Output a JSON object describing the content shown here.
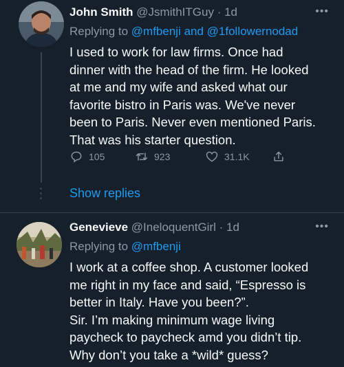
{
  "tweet1": {
    "name": "John Smith",
    "handle": "@JsmithITGuy",
    "time": "· 1d",
    "replying_prefix": "Replying to ",
    "replying_users": "@mfbenji and @1followernodad",
    "text_lines": [
      "I used to work for law firms. Once had",
      "dinner with the head of the firm. He looked",
      "at me and my wife and asked what our",
      "favorite bistro in Paris was. We've never",
      "been to Paris. Never even mentioned Paris.",
      "That was his starter question."
    ],
    "replies": "105",
    "retweets": "923",
    "likes": "31.1K"
  },
  "show_replies": "Show replies",
  "tweet2": {
    "name": "Genevieve",
    "handle": "@IneloquentGirl",
    "time": "· 1d",
    "replying_prefix": "Replying to ",
    "replying_users": "@mfbenji",
    "text_lines": [
      "I work at a coffee shop. A customer looked",
      "me right in my face and said, “Espresso is",
      "better in Italy. Have you been?”.",
      "Sir. I’m making minimum wage living",
      "paycheck to paycheck amd you didn’t tip.",
      "Why don’t you take a *wild* guess?"
    ]
  },
  "more_label": "•••",
  "colors": {
    "background": "#15202b",
    "accent": "#1d9bf0",
    "secondary_text": "#8b98a5",
    "border": "#38444d"
  },
  "icons": [
    "reply-icon",
    "retweet-icon",
    "like-icon",
    "share-icon",
    "more-icon"
  ]
}
